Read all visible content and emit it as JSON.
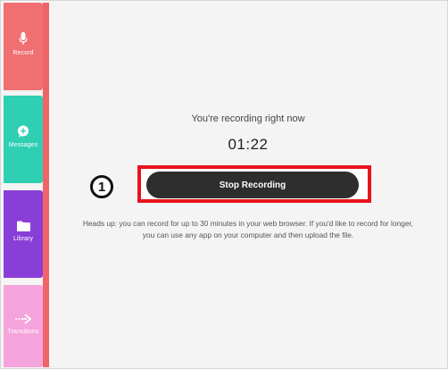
{
  "sidebar": {
    "items": [
      {
        "label": "Record",
        "icon": "microphone-icon",
        "color": "#f06f70"
      },
      {
        "label": "Messages",
        "icon": "chat-plus-icon",
        "color": "#2fcfb3"
      },
      {
        "label": "Library",
        "icon": "folder-icon",
        "color": "#8a3ed8"
      },
      {
        "label": "Transitions",
        "icon": "arrow-right-icon",
        "color": "#f5a3dc"
      }
    ]
  },
  "main": {
    "status": "You're recording right now",
    "timer": "01:22",
    "stop_button_label": "Stop Recording",
    "step_number": "1",
    "note_line1": "Heads up: you can record for up to 30 minutes in your web browser. If you'd like to record for longer,",
    "note_line2": "you can use any app on your computer and then upload the file."
  },
  "colors": {
    "highlight": "#e8141c",
    "button": "#2e2e2e",
    "accent_stripe": "#f06467"
  }
}
